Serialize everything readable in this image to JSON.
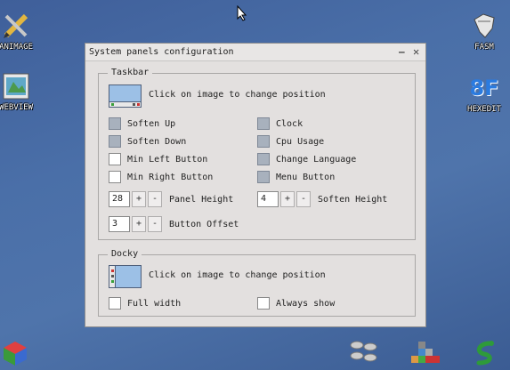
{
  "desktop": {
    "icons_left": [
      {
        "label": "ANIMAGE",
        "icon": "pencil-icon"
      },
      {
        "label": "WEBVIEW",
        "icon": "browser-icon"
      }
    ],
    "icons_right": [
      {
        "label": "FASM",
        "icon": "fasm-icon"
      },
      {
        "label": "HEXEDIT",
        "icon": "hexedit-icon"
      }
    ],
    "hexedit_glyph": "8F"
  },
  "window": {
    "title": "System panels configuration",
    "minimize_glyph": "—",
    "close_glyph": "✕"
  },
  "taskbar": {
    "title": "Taskbar",
    "hint": "Click on image to change position",
    "options_left": [
      {
        "label": "Soften Up",
        "checked": true
      },
      {
        "label": "Soften Down",
        "checked": true
      },
      {
        "label": "Min Left Button",
        "checked": false
      },
      {
        "label": "Min Right Button",
        "checked": false
      }
    ],
    "options_right": [
      {
        "label": "Clock",
        "checked": true
      },
      {
        "label": "Cpu Usage",
        "checked": true
      },
      {
        "label": "Change Language",
        "checked": true
      },
      {
        "label": "Menu Button",
        "checked": true
      }
    ],
    "panel_height": {
      "value": "28",
      "label": "Panel Height"
    },
    "soften_height": {
      "value": "4",
      "label": "Soften Height"
    },
    "button_offset": {
      "value": "3",
      "label": "Button Offset"
    },
    "plus": "+",
    "minus": "-"
  },
  "docky": {
    "title": "Docky",
    "hint": "Click on image to change position",
    "full_width": {
      "label": "Full width",
      "checked": false
    },
    "always_show": {
      "label": "Always show",
      "checked": false
    }
  }
}
